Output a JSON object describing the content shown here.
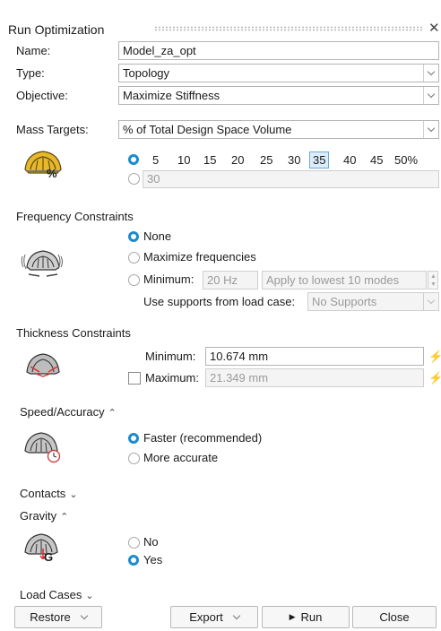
{
  "title": "Run Optimization",
  "name": {
    "label": "Name:",
    "value": "Model_za_opt"
  },
  "type": {
    "label": "Type:",
    "value": "Topology"
  },
  "objective": {
    "label": "Objective:",
    "value": "Maximize Stiffness"
  },
  "mass_targets": {
    "label": "Mass Targets:",
    "value": "% of Total Design Space Volume",
    "percent_options": [
      "5",
      "10",
      "15",
      "20",
      "25",
      "30",
      "35",
      "40",
      "45",
      "50%"
    ],
    "selected": "35",
    "custom_value": "30",
    "icon_label": "%"
  },
  "frequency": {
    "heading": "Frequency Constraints",
    "none_label": "None",
    "maximize_label": "Maximize frequencies",
    "minimum_label": "Minimum:",
    "minimum_value": "20 Hz",
    "apply_value": "Apply to lowest 10 modes",
    "supports_label": "Use supports from load case:",
    "supports_value": "No Supports",
    "selected": "None"
  },
  "thickness": {
    "heading": "Thickness Constraints",
    "minimum_label": "Minimum:",
    "minimum_value": "10.674 mm",
    "maximum_label": "Maximum:",
    "maximum_value": "21.349 mm"
  },
  "speed": {
    "heading": "Speed/Accuracy",
    "faster_label": "Faster (recommended)",
    "accurate_label": "More accurate",
    "selected": "Faster (recommended)"
  },
  "contacts": {
    "heading": "Contacts"
  },
  "gravity": {
    "heading": "Gravity",
    "no_label": "No",
    "yes_label": "Yes",
    "selected": "Yes",
    "icon_label": "G"
  },
  "load_cases": {
    "heading": "Load Cases"
  },
  "buttons": {
    "restore": "Restore",
    "export": "Export",
    "run": "Run",
    "close": "Close"
  },
  "colors": {
    "accent": "#1a8bd1",
    "selected_bg": "#dcecf8"
  },
  "icons": {
    "close": "close-icon",
    "collapse": "double-chevron-up-icon",
    "expand": "double-chevron-down-icon",
    "lock": "lightning-icon",
    "run": "play-icon"
  }
}
